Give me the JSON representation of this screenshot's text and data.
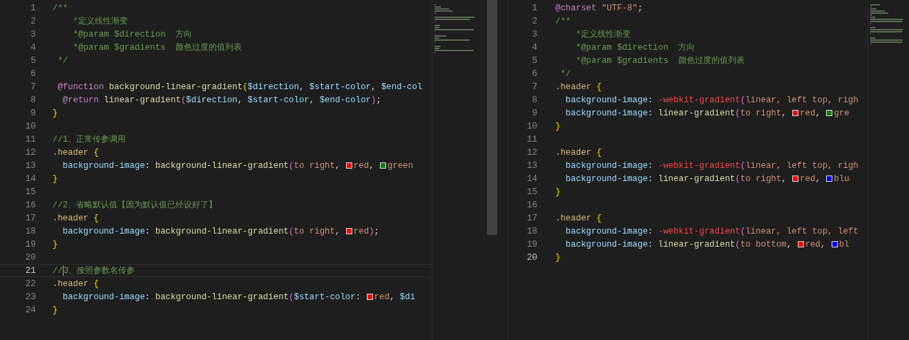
{
  "editors": [
    {
      "focused": true,
      "lines": [
        {
          "number": "1",
          "active": false,
          "tokens": [
            {
              "kind": "comment",
              "text": "/**"
            }
          ]
        },
        {
          "number": "2",
          "active": false,
          "tokens": [
            {
              "kind": "comment",
              "text": "    *定义线性渐变"
            }
          ]
        },
        {
          "number": "3",
          "active": false,
          "tokens": [
            {
              "kind": "comment",
              "text": "    *@param $direction  方向"
            }
          ]
        },
        {
          "number": "4",
          "active": false,
          "tokens": [
            {
              "kind": "comment",
              "text": "    *@param $gradients  颜色过度的值列表"
            }
          ]
        },
        {
          "number": "5",
          "active": false,
          "tokens": [
            {
              "kind": "comment",
              "text": " */"
            }
          ]
        },
        {
          "number": "6",
          "active": false
        },
        {
          "number": "7",
          "active": false,
          "tokens": [
            {
              "kind": "keyword",
              "text": " @function "
            },
            {
              "kind": "function",
              "text": "background-linear-gradient"
            },
            {
              "kind": "brace",
              "text": "("
            },
            {
              "kind": "variable",
              "text": "$direction"
            },
            {
              "kind": "plain",
              "text": ", "
            },
            {
              "kind": "variable",
              "text": "$start-color"
            },
            {
              "kind": "plain",
              "text": ", "
            },
            {
              "kind": "variable",
              "text": "$end-col"
            }
          ]
        },
        {
          "number": "8",
          "active": false,
          "tokens": [
            {
              "kind": "keyword",
              "text": "  @return "
            },
            {
              "kind": "function",
              "text": "linear-gradient"
            },
            {
              "kind": "paren",
              "text": "("
            },
            {
              "kind": "variable",
              "text": "$direction"
            },
            {
              "kind": "plain",
              "text": ", "
            },
            {
              "kind": "variable",
              "text": "$start-color"
            },
            {
              "kind": "plain",
              "text": ", "
            },
            {
              "kind": "variable",
              "text": "$end-color"
            },
            {
              "kind": "paren",
              "text": ")"
            },
            {
              "kind": "plain",
              "text": ";"
            }
          ]
        },
        {
          "number": "9",
          "active": false,
          "tokens": [
            {
              "kind": "brace",
              "text": "}"
            }
          ]
        },
        {
          "number": "10",
          "active": false
        },
        {
          "number": "11",
          "active": false,
          "tokens": [
            {
              "kind": "comment",
              "text": "//1、正常传参调用"
            }
          ]
        },
        {
          "number": "12",
          "active": false,
          "tokens": [
            {
              "kind": "selector",
              "text": ".header "
            },
            {
              "kind": "brace",
              "text": "{"
            }
          ]
        },
        {
          "number": "13",
          "active": false,
          "tokens": [
            {
              "kind": "property",
              "text": "  background-image"
            },
            {
              "kind": "plain",
              "text": ": "
            },
            {
              "kind": "function",
              "text": "background-linear-gradient"
            },
            {
              "kind": "paren",
              "text": "("
            },
            {
              "kind": "value",
              "text": "to right"
            },
            {
              "kind": "plain",
              "text": ", "
            },
            {
              "kind": "swatch",
              "color": "#ff0000"
            },
            {
              "kind": "value",
              "text": "red"
            },
            {
              "kind": "plain",
              "text": ", "
            },
            {
              "kind": "swatch",
              "color": "#008000"
            },
            {
              "kind": "value",
              "text": "green"
            }
          ]
        },
        {
          "number": "14",
          "active": false,
          "tokens": [
            {
              "kind": "brace",
              "text": "}"
            }
          ]
        },
        {
          "number": "15",
          "active": false
        },
        {
          "number": "16",
          "active": false,
          "tokens": [
            {
              "kind": "comment",
              "text": "//2、省略默认值【因为默认值已经设好了】"
            }
          ]
        },
        {
          "number": "17",
          "active": false,
          "tokens": [
            {
              "kind": "selector",
              "text": ".header "
            },
            {
              "kind": "brace",
              "text": "{"
            }
          ]
        },
        {
          "number": "18",
          "active": false,
          "tokens": [
            {
              "kind": "property",
              "text": "  background-image"
            },
            {
              "kind": "plain",
              "text": ": "
            },
            {
              "kind": "function",
              "text": "background-linear-gradient"
            },
            {
              "kind": "paren",
              "text": "("
            },
            {
              "kind": "value",
              "text": "to right"
            },
            {
              "kind": "plain",
              "text": ", "
            },
            {
              "kind": "swatch",
              "color": "#ff0000"
            },
            {
              "kind": "value",
              "text": "red"
            },
            {
              "kind": "paren",
              "text": ")"
            },
            {
              "kind": "plain",
              "text": ";"
            }
          ]
        },
        {
          "number": "19",
          "active": false,
          "tokens": [
            {
              "kind": "brace",
              "text": "}"
            }
          ]
        },
        {
          "number": "20",
          "active": false
        },
        {
          "number": "21",
          "active": true,
          "tokens": [
            {
              "kind": "comment",
              "text": "//"
            },
            {
              "kind": "cursor"
            },
            {
              "kind": "comment",
              "text": "3、按照参数名传参"
            }
          ]
        },
        {
          "number": "22",
          "active": false,
          "tokens": [
            {
              "kind": "selector",
              "text": ".header "
            },
            {
              "kind": "brace",
              "text": "{"
            }
          ]
        },
        {
          "number": "23",
          "active": false,
          "tokens": [
            {
              "kind": "property",
              "text": "  background-image"
            },
            {
              "kind": "plain",
              "text": ": "
            },
            {
              "kind": "function",
              "text": "background-linear-gradient"
            },
            {
              "kind": "paren",
              "text": "("
            },
            {
              "kind": "variable",
              "text": "$start-color"
            },
            {
              "kind": "plain",
              "text": ": "
            },
            {
              "kind": "swatch",
              "color": "#ff0000"
            },
            {
              "kind": "value",
              "text": "red"
            },
            {
              "kind": "plain",
              "text": ", "
            },
            {
              "kind": "variable",
              "text": "$di"
            }
          ]
        },
        {
          "number": "24",
          "active": false,
          "tokens": [
            {
              "kind": "brace",
              "text": "}"
            }
          ]
        }
      ]
    },
    {
      "focused": false,
      "lines": [
        {
          "number": "1",
          "active": false,
          "tokens": [
            {
              "kind": "keyword",
              "text": "@charset "
            },
            {
              "kind": "value",
              "text": "\"UTF-8\""
            },
            {
              "kind": "plain",
              "text": ";"
            }
          ]
        },
        {
          "number": "2",
          "active": false,
          "tokens": [
            {
              "kind": "comment",
              "text": "/**"
            }
          ]
        },
        {
          "number": "3",
          "active": false,
          "tokens": [
            {
              "kind": "comment",
              "text": "    *定义线性渐变"
            }
          ]
        },
        {
          "number": "4",
          "active": false,
          "tokens": [
            {
              "kind": "comment",
              "text": "    *@param $direction  方向"
            }
          ]
        },
        {
          "number": "5",
          "active": false,
          "tokens": [
            {
              "kind": "comment",
              "text": "    *@param $gradients  颜色过度的值列表"
            }
          ]
        },
        {
          "number": "6",
          "active": false,
          "tokens": [
            {
              "kind": "comment",
              "text": " */"
            }
          ]
        },
        {
          "number": "7",
          "active": false,
          "tokens": [
            {
              "kind": "selector",
              "text": ".header "
            },
            {
              "kind": "brace",
              "text": "{"
            }
          ]
        },
        {
          "number": "8",
          "active": false,
          "tokens": [
            {
              "kind": "property",
              "text": "  background-image"
            },
            {
              "kind": "plain",
              "text": ": "
            },
            {
              "kind": "vendor",
              "text": "-webkit-gradient"
            },
            {
              "kind": "paren",
              "text": "("
            },
            {
              "kind": "value",
              "text": "linear, left top, righ"
            }
          ]
        },
        {
          "number": "9",
          "active": false,
          "tokens": [
            {
              "kind": "property",
              "text": "  background-image"
            },
            {
              "kind": "plain",
              "text": ": "
            },
            {
              "kind": "function",
              "text": "linear-gradient"
            },
            {
              "kind": "paren",
              "text": "("
            },
            {
              "kind": "value",
              "text": "to right"
            },
            {
              "kind": "plain",
              "text": ", "
            },
            {
              "kind": "swatch",
              "color": "#ff0000"
            },
            {
              "kind": "value",
              "text": "red"
            },
            {
              "kind": "plain",
              "text": ", "
            },
            {
              "kind": "swatch",
              "color": "#008000"
            },
            {
              "kind": "value",
              "text": "gre"
            }
          ]
        },
        {
          "number": "10",
          "active": false,
          "tokens": [
            {
              "kind": "brace",
              "text": "}"
            }
          ]
        },
        {
          "number": "11",
          "active": false
        },
        {
          "number": "12",
          "active": false,
          "tokens": [
            {
              "kind": "selector",
              "text": ".header "
            },
            {
              "kind": "brace",
              "text": "{"
            }
          ]
        },
        {
          "number": "13",
          "active": false,
          "tokens": [
            {
              "kind": "property",
              "text": "  background-image"
            },
            {
              "kind": "plain",
              "text": ": "
            },
            {
              "kind": "vendor",
              "text": "-webkit-gradient"
            },
            {
              "kind": "paren",
              "text": "("
            },
            {
              "kind": "value",
              "text": "linear, left top, righ"
            }
          ]
        },
        {
          "number": "14",
          "active": false,
          "tokens": [
            {
              "kind": "property",
              "text": "  background-image"
            },
            {
              "kind": "plain",
              "text": ": "
            },
            {
              "kind": "function",
              "text": "linear-gradient"
            },
            {
              "kind": "paren",
              "text": "("
            },
            {
              "kind": "value",
              "text": "to right"
            },
            {
              "kind": "plain",
              "text": ", "
            },
            {
              "kind": "swatch",
              "color": "#ff0000"
            },
            {
              "kind": "value",
              "text": "red"
            },
            {
              "kind": "plain",
              "text": ", "
            },
            {
              "kind": "swatch",
              "color": "#0000ff"
            },
            {
              "kind": "value",
              "text": "blu"
            }
          ]
        },
        {
          "number": "15",
          "active": false,
          "tokens": [
            {
              "kind": "brace",
              "text": "}"
            }
          ]
        },
        {
          "number": "16",
          "active": false
        },
        {
          "number": "17",
          "active": false,
          "tokens": [
            {
              "kind": "selector",
              "text": ".header "
            },
            {
              "kind": "brace",
              "text": "{"
            }
          ]
        },
        {
          "number": "18",
          "active": false,
          "tokens": [
            {
              "kind": "property",
              "text": "  background-image"
            },
            {
              "kind": "plain",
              "text": ": "
            },
            {
              "kind": "vendor",
              "text": "-webkit-gradient"
            },
            {
              "kind": "paren",
              "text": "("
            },
            {
              "kind": "value",
              "text": "linear, left top, left"
            }
          ]
        },
        {
          "number": "19",
          "active": false,
          "tokens": [
            {
              "kind": "property",
              "text": "  background-image"
            },
            {
              "kind": "plain",
              "text": ": "
            },
            {
              "kind": "function",
              "text": "linear-gradient"
            },
            {
              "kind": "paren",
              "text": "("
            },
            {
              "kind": "value",
              "text": "to bottom"
            },
            {
              "kind": "plain",
              "text": ", "
            },
            {
              "kind": "swatch",
              "color": "#ff0000"
            },
            {
              "kind": "value",
              "text": "red"
            },
            {
              "kind": "plain",
              "text": ", "
            },
            {
              "kind": "swatch",
              "color": "#0000ff"
            },
            {
              "kind": "value",
              "text": "bl"
            }
          ]
        },
        {
          "number": "20",
          "active": true,
          "tokens": [
            {
              "kind": "brace",
              "text": "}"
            }
          ]
        }
      ]
    }
  ]
}
